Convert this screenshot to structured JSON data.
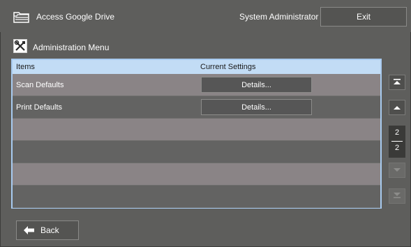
{
  "header": {
    "app_title": "Access Google Drive",
    "user_label": "System Administrator",
    "exit_label": "Exit"
  },
  "menu": {
    "title": "Administration Menu"
  },
  "list": {
    "columns": [
      "Items",
      "Current Settings"
    ],
    "rows": [
      {
        "label": "Scan Defaults",
        "action": "Details..."
      },
      {
        "label": "Print Defaults",
        "action": "Details..."
      }
    ],
    "empty_row_count_shown": 4
  },
  "pagination": {
    "current": "2",
    "total": "2"
  },
  "footer": {
    "back_label": "Back"
  },
  "icons": {
    "header": "folder-icon",
    "menu": "tools-icon",
    "back": "arrow-left-icon"
  },
  "colors": {
    "background": "#5e5e5c",
    "list_border": "#a8cbf0",
    "list_header": "#c2dcf5",
    "row_light": "#8a8486",
    "row_dark": "#636362"
  }
}
